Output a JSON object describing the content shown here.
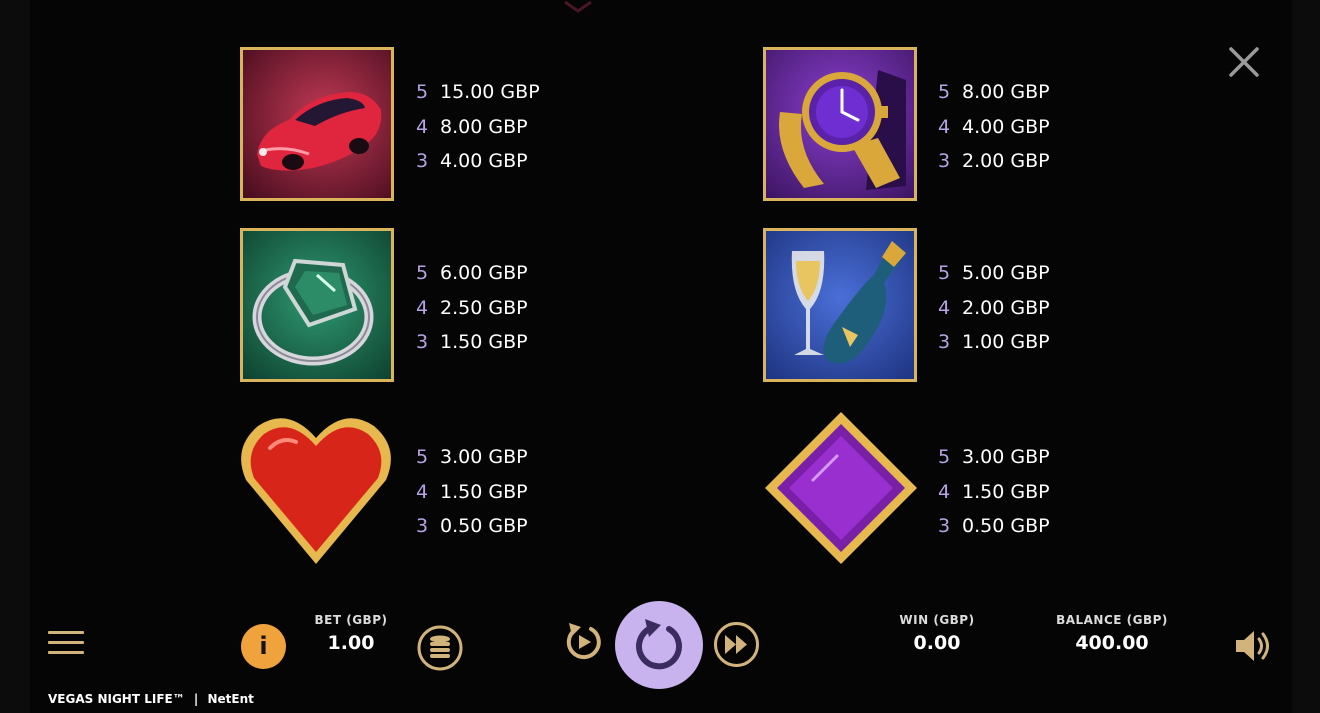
{
  "paytable": {
    "car": [
      {
        "count": "5",
        "amount": "15.00 GBP"
      },
      {
        "count": "4",
        "amount": "8.00 GBP"
      },
      {
        "count": "3",
        "amount": "4.00 GBP"
      }
    ],
    "watch": [
      {
        "count": "5",
        "amount": "8.00 GBP"
      },
      {
        "count": "4",
        "amount": "4.00 GBP"
      },
      {
        "count": "3",
        "amount": "2.00 GBP"
      }
    ],
    "ring": [
      {
        "count": "5",
        "amount": "6.00 GBP"
      },
      {
        "count": "4",
        "amount": "2.50 GBP"
      },
      {
        "count": "3",
        "amount": "1.50 GBP"
      }
    ],
    "champagne": [
      {
        "count": "5",
        "amount": "5.00 GBP"
      },
      {
        "count": "4",
        "amount": "2.00 GBP"
      },
      {
        "count": "3",
        "amount": "1.00 GBP"
      }
    ],
    "heart": [
      {
        "count": "5",
        "amount": "3.00 GBP"
      },
      {
        "count": "4",
        "amount": "1.50 GBP"
      },
      {
        "count": "3",
        "amount": "0.50 GBP"
      }
    ],
    "diamond": [
      {
        "count": "5",
        "amount": "3.00 GBP"
      },
      {
        "count": "4",
        "amount": "1.50 GBP"
      },
      {
        "count": "3",
        "amount": "0.50 GBP"
      }
    ]
  },
  "bottom_bar": {
    "bet_label": "BET (GBP)",
    "bet_value": "1.00",
    "win_label": "WIN (GBP)",
    "win_value": "0.00",
    "balance_label": "BALANCE (GBP)",
    "balance_value": "400.00",
    "info_glyph": "i"
  },
  "footer": {
    "game_title": "VEGAS NIGHT LIFE™",
    "separator": "|",
    "provider": "NetEnt"
  },
  "icons": {
    "close": "close-icon",
    "menu": "hamburger-menu-icon",
    "coins": "coin-stack-icon",
    "autoplay": "autoplay-icon",
    "spin": "spin-icon",
    "turbo": "fast-forward-icon",
    "sound": "speaker-icon"
  },
  "colors": {
    "background": "#050505",
    "gold_frame": "#d9b45a",
    "count_text": "#b6a4e6",
    "accent_orange": "#f0a33c",
    "spin_button": "#c8b3ef",
    "control_gold": "#d2b37c"
  }
}
